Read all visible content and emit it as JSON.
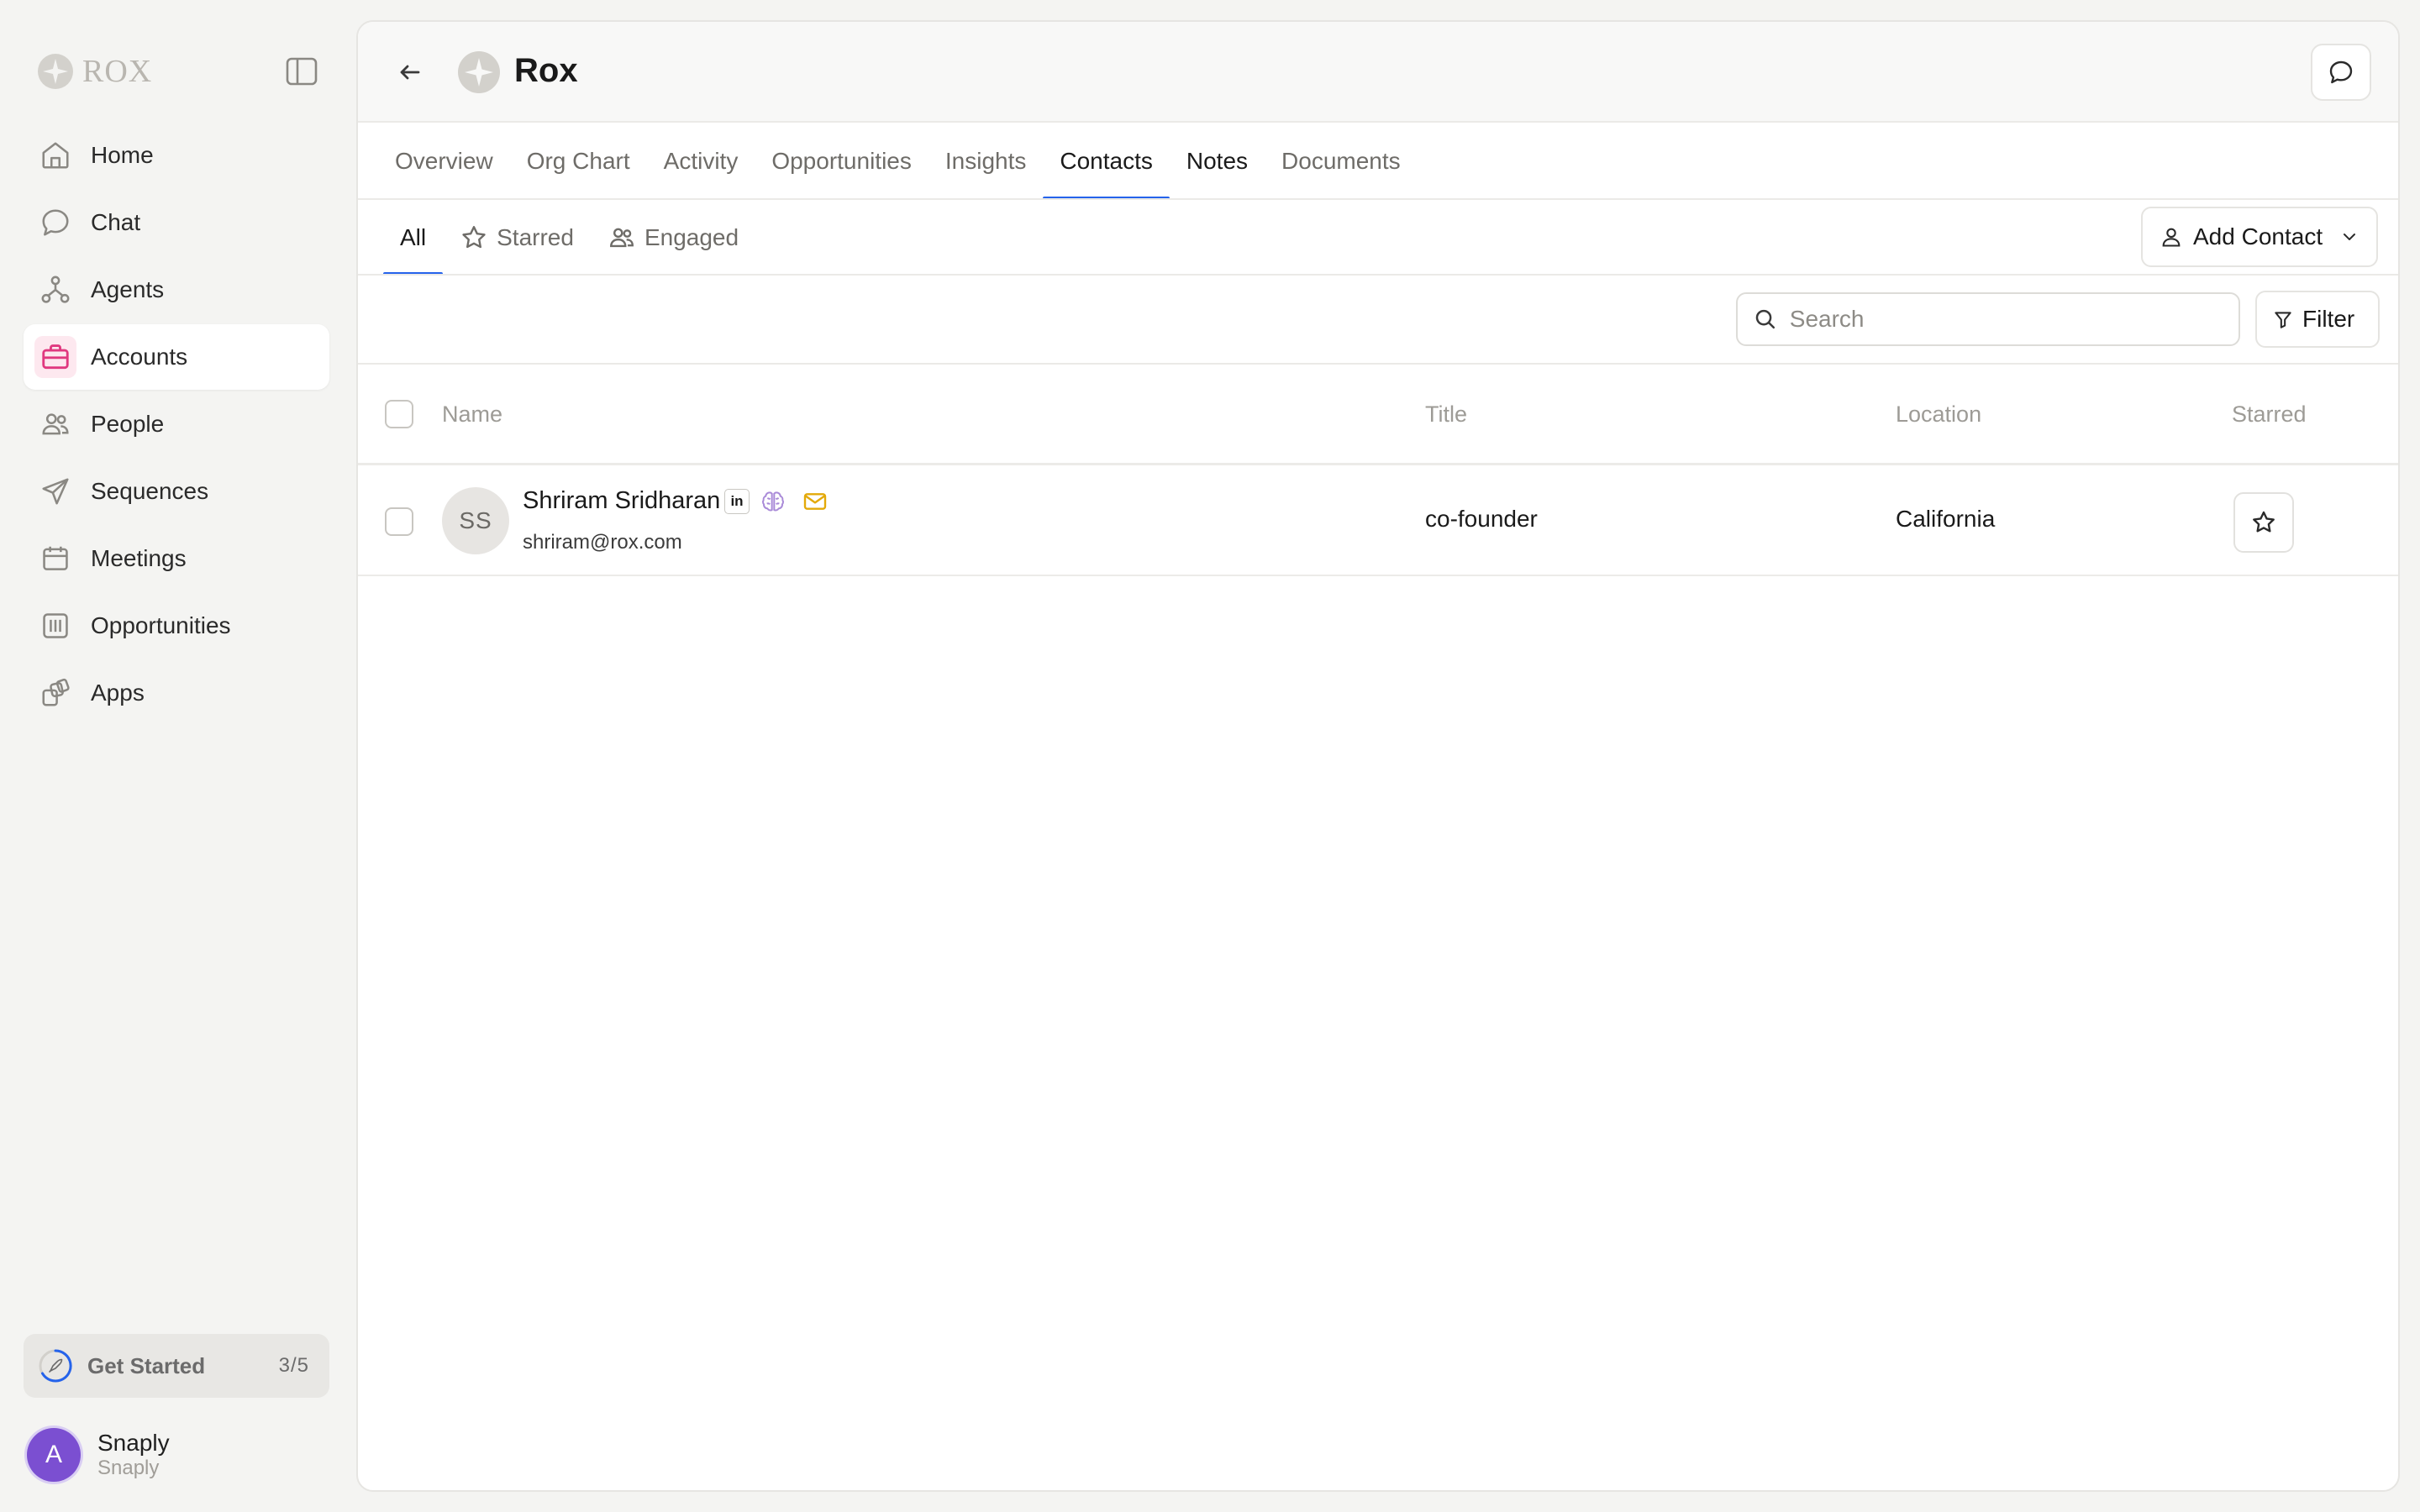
{
  "brand": {
    "logo_text": "ROX"
  },
  "sidebar": {
    "items": [
      {
        "label": "Home",
        "icon": "home-icon"
      },
      {
        "label": "Chat",
        "icon": "chat-icon"
      },
      {
        "label": "Agents",
        "icon": "agents-icon"
      },
      {
        "label": "Accounts",
        "icon": "briefcase-icon",
        "active": true
      },
      {
        "label": "People",
        "icon": "people-icon"
      },
      {
        "label": "Sequences",
        "icon": "send-icon"
      },
      {
        "label": "Meetings",
        "icon": "calendar-icon"
      },
      {
        "label": "Opportunities",
        "icon": "columns-icon"
      },
      {
        "label": "Apps",
        "icon": "apps-icon"
      }
    ],
    "get_started": {
      "label": "Get Started",
      "count": "3/5"
    },
    "user": {
      "initial": "A",
      "name": "Snaply",
      "org": "Snaply"
    }
  },
  "header": {
    "account_name": "Rox"
  },
  "tabs": [
    {
      "label": "Overview"
    },
    {
      "label": "Org Chart"
    },
    {
      "label": "Activity"
    },
    {
      "label": "Opportunities"
    },
    {
      "label": "Insights"
    },
    {
      "label": "Contacts",
      "active": true
    },
    {
      "label": "Notes"
    },
    {
      "label": "Documents"
    }
  ],
  "subtabs": [
    {
      "label": "All",
      "active": true
    },
    {
      "label": "Starred",
      "icon": "star-icon"
    },
    {
      "label": "Engaged",
      "icon": "people-icon"
    }
  ],
  "actions": {
    "add_contact": "Add Contact",
    "filter": "Filter"
  },
  "search": {
    "placeholder": "Search",
    "value": ""
  },
  "table": {
    "columns": {
      "name": "Name",
      "title": "Title",
      "location": "Location",
      "starred": "Starred"
    },
    "rows": [
      {
        "initials": "SS",
        "name": "Shriram Sridharan",
        "email": "shriram@rox.com",
        "title": "co-founder",
        "location": "California",
        "linkedin_badge": "in"
      }
    ]
  },
  "colors": {
    "accent": "#2563eb",
    "accounts_icon": "#e0387f",
    "email_badge": "#e3a909",
    "user_avatar": "#7b4fd1"
  }
}
